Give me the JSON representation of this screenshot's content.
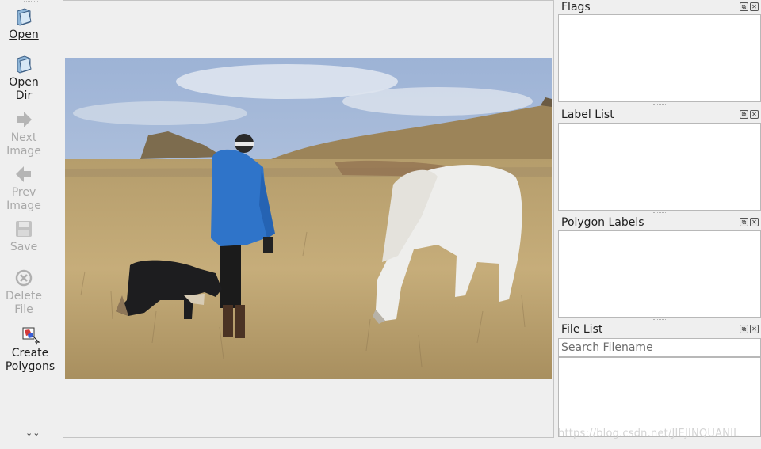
{
  "toolbar": {
    "open": {
      "label": "Open",
      "icon": "folder-open-icon"
    },
    "open_dir": {
      "label": "Open\nDir",
      "icon": "folder-open-icon"
    },
    "next_image": {
      "label": "Next\nImage",
      "icon": "arrow-right-icon"
    },
    "prev_image": {
      "label": "Prev\nImage",
      "icon": "arrow-left-icon"
    },
    "save": {
      "label": "Save",
      "icon": "floppy-disk-icon"
    },
    "delete_file": {
      "label": "Delete\nFile",
      "icon": "delete-circle-icon"
    },
    "create_polygons": {
      "label": "Create\nPolygons",
      "icon": "create-polygon-icon"
    },
    "more_icon": "chevron-double-down-icon"
  },
  "panels": {
    "flags": {
      "title": "Flags"
    },
    "label_list": {
      "title": "Label List"
    },
    "polygon_labels": {
      "title": "Polygon Labels"
    },
    "file_list": {
      "title": "File List",
      "search_placeholder": "Search Filename"
    }
  },
  "watermark": "https://blog.csdn.net/JIEJINQUANIL",
  "colors": {
    "window_bg": "#efefef",
    "panel_bg": "#ffffff",
    "border": "#b8b8b8",
    "disabled_text": "#a9a9a9"
  }
}
